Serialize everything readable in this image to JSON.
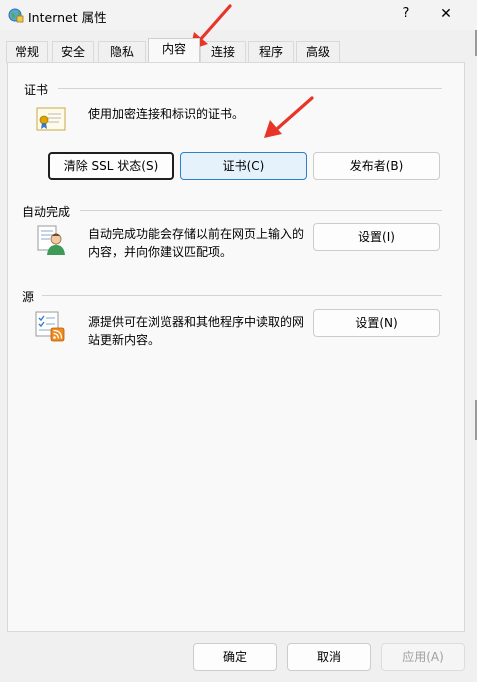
{
  "window": {
    "title": "Internet 属性",
    "help": "?",
    "close": "✕"
  },
  "tabs": [
    {
      "label": "常规"
    },
    {
      "label": "安全"
    },
    {
      "label": "隐私"
    },
    {
      "label": "内容"
    },
    {
      "label": "连接"
    },
    {
      "label": "程序"
    },
    {
      "label": "高级"
    }
  ],
  "certificates": {
    "heading": "证书",
    "description": "使用加密连接和标识的证书。",
    "clear_ssl": "清除 SSL 状态(S)",
    "certificates_button": "证书(C)",
    "publishers_button": "发布者(B)"
  },
  "autocomplete": {
    "heading": "自动完成",
    "description_line1": "自动完成功能会存储以前在网页上输入的",
    "description_line2": "内容，并向你建议匹配项。",
    "settings_button": "设置(I)"
  },
  "feeds": {
    "heading": "源",
    "description_line1": "源提供可在浏览器和其他程序中读取的网",
    "description_line2": "站更新内容。",
    "settings_button": "设置(N)"
  },
  "footer": {
    "ok": "确定",
    "cancel": "取消",
    "apply": "应用(A)"
  },
  "colors": {
    "annotation_arrow": "#e8352a",
    "hover_border": "#2f7fc7",
    "hover_fill": "#e5f1fb"
  }
}
